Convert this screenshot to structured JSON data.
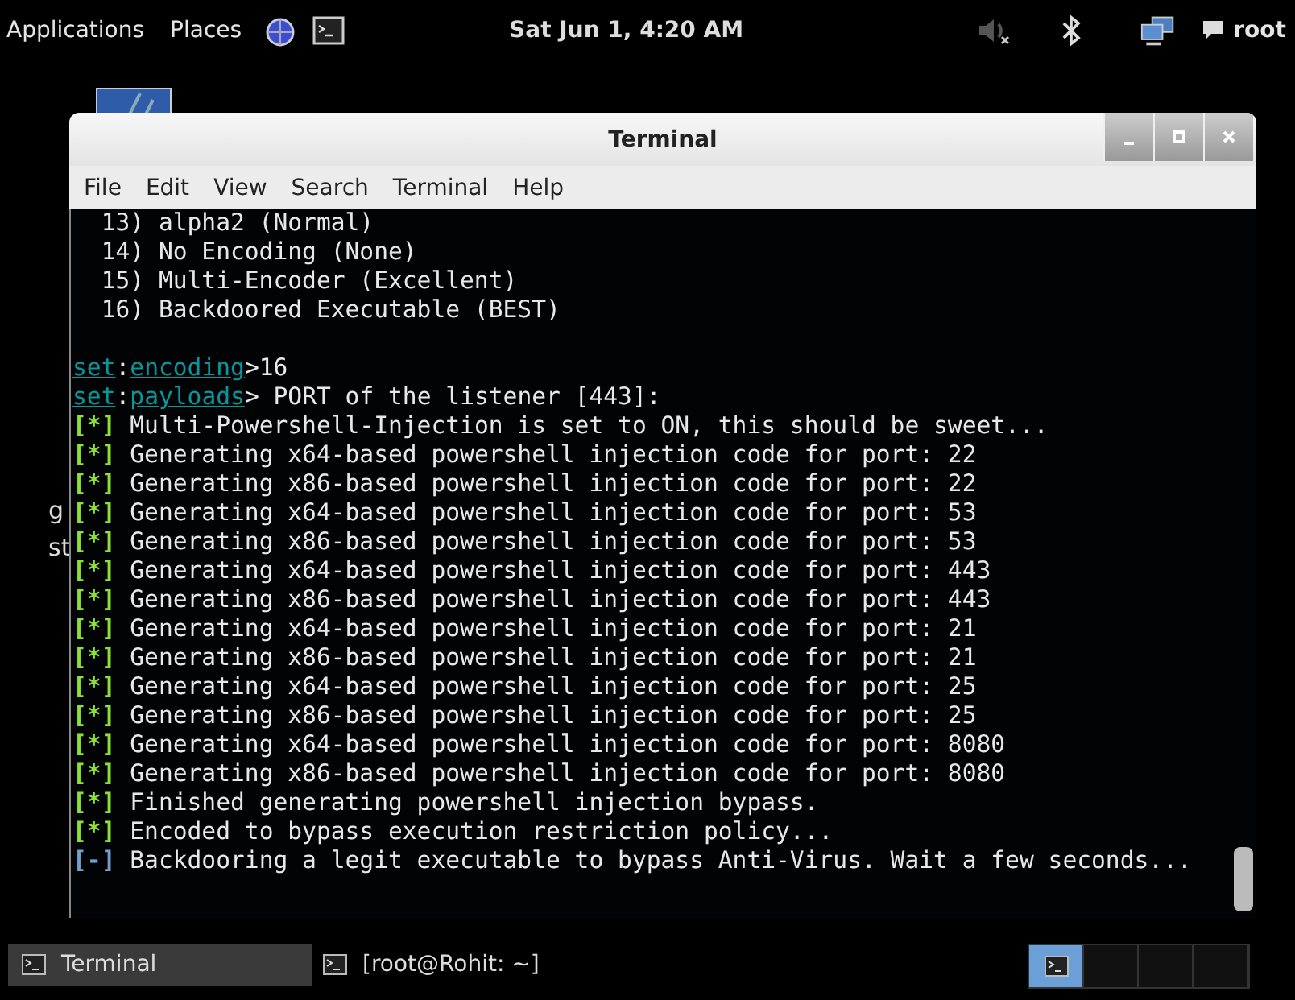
{
  "top_panel": {
    "menus": [
      "Applications",
      "Places"
    ],
    "clock": "Sat Jun  1, 4:20 AM",
    "user": "root"
  },
  "desktop": {
    "labels": [
      "g",
      "st"
    ]
  },
  "window": {
    "title": "Terminal",
    "menu": [
      "File",
      "Edit",
      "View",
      "Search",
      "Terminal",
      "Help"
    ],
    "lines": [
      {
        "kind": "plain",
        "text": "  13) alpha2 (Normal)"
      },
      {
        "kind": "plain",
        "text": "  14) No Encoding (None)"
      },
      {
        "kind": "plain",
        "text": "  15) Multi-Encoder (Excellent)"
      },
      {
        "kind": "plain",
        "text": "  16) Backdoored Executable (BEST)"
      },
      {
        "kind": "blank"
      },
      {
        "kind": "prompt",
        "prefix": "set",
        "sep": ":",
        "module": "encoding",
        "text": ">16"
      },
      {
        "kind": "prompt",
        "prefix": "set",
        "sep": ":",
        "module": "payloads",
        "text": "> PORT of the listener [443]:"
      },
      {
        "kind": "status",
        "mark": "[*]",
        "color": "#8ae234",
        "text": " Multi-Powershell-Injection is set to ON, this should be sweet..."
      },
      {
        "kind": "status",
        "mark": "[*]",
        "color": "#8ae234",
        "text": " Generating x64-based powershell injection code for port: 22"
      },
      {
        "kind": "status",
        "mark": "[*]",
        "color": "#8ae234",
        "text": " Generating x86-based powershell injection code for port: 22"
      },
      {
        "kind": "status",
        "mark": "[*]",
        "color": "#8ae234",
        "text": " Generating x64-based powershell injection code for port: 53"
      },
      {
        "kind": "status",
        "mark": "[*]",
        "color": "#8ae234",
        "text": " Generating x86-based powershell injection code for port: 53"
      },
      {
        "kind": "status",
        "mark": "[*]",
        "color": "#8ae234",
        "text": " Generating x64-based powershell injection code for port: 443"
      },
      {
        "kind": "status",
        "mark": "[*]",
        "color": "#8ae234",
        "text": " Generating x86-based powershell injection code for port: 443"
      },
      {
        "kind": "status",
        "mark": "[*]",
        "color": "#8ae234",
        "text": " Generating x64-based powershell injection code for port: 21"
      },
      {
        "kind": "status",
        "mark": "[*]",
        "color": "#8ae234",
        "text": " Generating x86-based powershell injection code for port: 21"
      },
      {
        "kind": "status",
        "mark": "[*]",
        "color": "#8ae234",
        "text": " Generating x64-based powershell injection code for port: 25"
      },
      {
        "kind": "status",
        "mark": "[*]",
        "color": "#8ae234",
        "text": " Generating x86-based powershell injection code for port: 25"
      },
      {
        "kind": "status",
        "mark": "[*]",
        "color": "#8ae234",
        "text": " Generating x64-based powershell injection code for port: 8080"
      },
      {
        "kind": "status",
        "mark": "[*]",
        "color": "#8ae234",
        "text": " Generating x86-based powershell injection code for port: 8080"
      },
      {
        "kind": "status",
        "mark": "[*]",
        "color": "#8ae234",
        "text": " Finished generating powershell injection bypass."
      },
      {
        "kind": "status",
        "mark": "[*]",
        "color": "#8ae234",
        "text": " Encoded to bypass execution restriction policy..."
      },
      {
        "kind": "status",
        "mark": "[-]",
        "color": "#729fcf",
        "text": " Backdooring a legit executable to bypass Anti-Virus. Wait a few seconds..."
      }
    ]
  },
  "taskbar": {
    "tasks": [
      {
        "label": "Terminal",
        "selected": true
      },
      {
        "label": "[root@Rohit: ~]",
        "selected": false
      }
    ],
    "workspaces": [
      {
        "selected": true
      },
      {
        "selected": false
      },
      {
        "selected": false
      },
      {
        "selected": false
      }
    ]
  }
}
